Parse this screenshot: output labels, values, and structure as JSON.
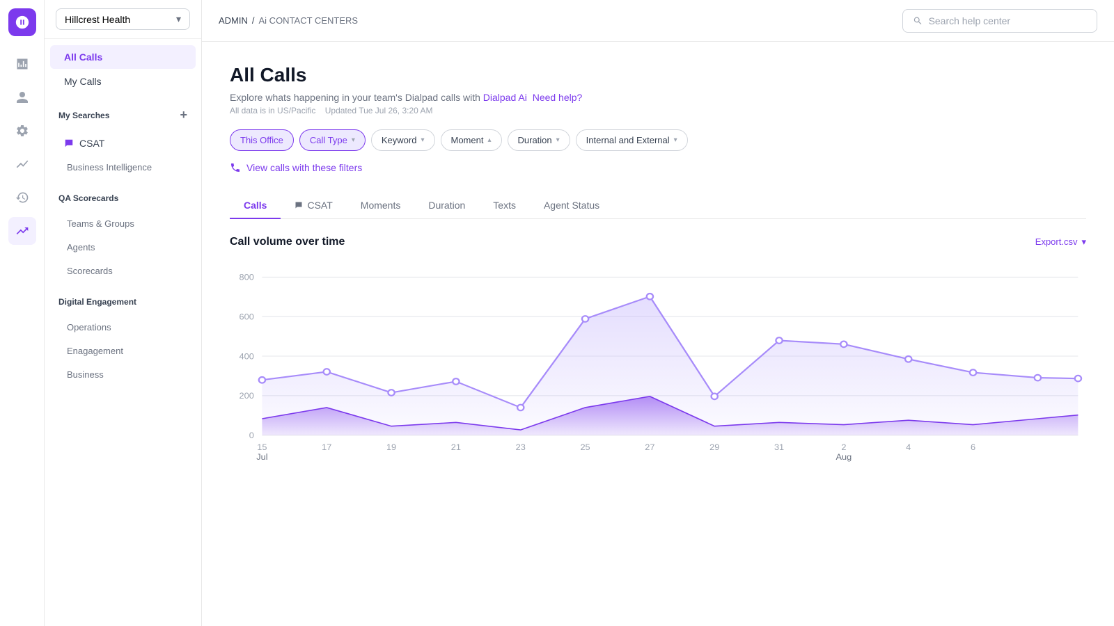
{
  "app": {
    "icon_label": "AI",
    "org_name": "Hillcrest Health"
  },
  "header": {
    "breadcrumb_admin": "ADMIN",
    "breadcrumb_sep": "/",
    "breadcrumb_section": "Ai CONTACT CENTERS",
    "search_placeholder": "Search help center"
  },
  "sidebar": {
    "nav_items": [
      {
        "label": "All Calls",
        "active": true
      },
      {
        "label": "My Calls",
        "active": false
      }
    ],
    "my_searches_label": "My Searches",
    "csat_label": "CSAT",
    "csat_sub": [],
    "bi_label": "Business Intelligence",
    "qa_label": "QA Scorecards",
    "qa_items": [
      "Teams & Groups",
      "Agents",
      "Scorecards"
    ],
    "digital_label": "Digital Engagement",
    "digital_items": [
      "Operations",
      "Enagagement",
      "Business"
    ]
  },
  "page": {
    "title": "All Calls",
    "description": "Explore whats happening in your team's Dialpad calls with",
    "link1": "Dialpad Ai",
    "link2": "Need help?",
    "meta_timezone": "All data is in US/Pacific",
    "meta_updated": "Updated Tue Jul 26, 3:20 AM"
  },
  "filters": [
    {
      "label": "This Office",
      "active": true,
      "has_chevron": false
    },
    {
      "label": "Call Type",
      "active": true,
      "has_chevron": true
    },
    {
      "label": "Keyword",
      "active": false,
      "has_chevron": true
    },
    {
      "label": "Moment",
      "active": false,
      "has_chevron": true,
      "up": true
    },
    {
      "label": "Duration",
      "active": false,
      "has_chevron": true
    },
    {
      "label": "Internal and External",
      "active": false,
      "has_chevron": true
    }
  ],
  "view_calls_link": "View calls with these filters",
  "tabs": [
    {
      "label": "Calls",
      "active": true,
      "icon": false
    },
    {
      "label": "CSAT",
      "active": false,
      "icon": true
    },
    {
      "label": "Moments",
      "active": false,
      "icon": false
    },
    {
      "label": "Duration",
      "active": false,
      "icon": false
    },
    {
      "label": "Texts",
      "active": false,
      "icon": false
    },
    {
      "label": "Agent Status",
      "active": false,
      "icon": false
    }
  ],
  "chart": {
    "title": "Call volume over time",
    "export_label": "Export.csv",
    "y_labels": [
      "800",
      "600",
      "400",
      "200",
      "0"
    ],
    "x_labels": [
      "15",
      "17",
      "19",
      "21",
      "23",
      "25",
      "27",
      "29",
      "31",
      "2",
      "4",
      "6"
    ],
    "x_months": {
      "15": "Jul",
      "2": "Aug"
    }
  },
  "icons": {
    "chevron_down": "▾",
    "chevron_up": "▴",
    "plus": "+",
    "search": "🔍",
    "phone": "📞",
    "analytics": "📊",
    "person": "👤",
    "settings": "⚙",
    "chart_line": "📈",
    "ai_logo": "Ai"
  }
}
